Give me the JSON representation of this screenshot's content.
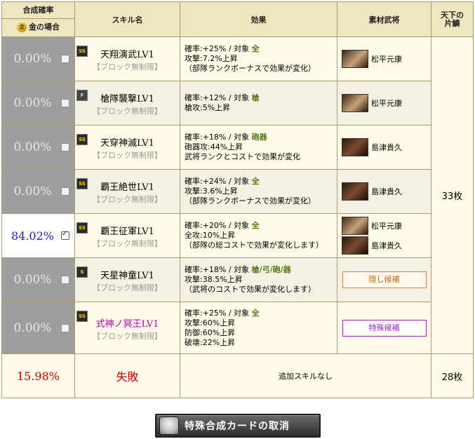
{
  "header": {
    "rate_title": "合成確率",
    "gold_case": "金の場合",
    "gold_coin": "金",
    "skill_name": "スキル名",
    "effect": "効果",
    "material": "素材武将",
    "fragments_1": "天下の",
    "fragments_2": "片鱗"
  },
  "rows": [
    {
      "rate": "0.00%",
      "rank": "SS",
      "name": "天翔演武LV1",
      "sub": "【ブロック無制限】",
      "e1a": "確率:+25%  /  対象 ",
      "e1b": "全",
      "e2": "攻撃:7.2%上昇",
      "e3": "（部隊ランクボーナスで効果が変化）",
      "generals": [
        "松平元康"
      ]
    },
    {
      "rate": "0.00%",
      "rank": "F",
      "name": "槍隊襲撃LV1",
      "sub": "【ブロック無制限】",
      "e1a": "確率:+12%  /  対象 ",
      "e1b": "槍",
      "e2": "槍攻:5%上昇",
      "e3": "",
      "generals": [
        "松平元康"
      ]
    },
    {
      "rate": "0.00%",
      "rank": "SS",
      "name": "天穿神滅LV1",
      "sub": "【ブロック無制限】",
      "e1a": "確率:+18%  /  対象 ",
      "e1b": "砲器",
      "e2": "砲器攻:44%上昇",
      "e3": "武将ランクとコストで効果が変化",
      "generals": [
        "島津貴久"
      ]
    },
    {
      "rate": "0.00%",
      "rank": "SS",
      "name": "覇王絶世LV1",
      "sub": "【ブロック無制限】",
      "e1a": "確率:+24%  /  対象 ",
      "e1b": "全",
      "e2": "攻撃:3.6%上昇",
      "e3": "（部隊ランクボーナスで効果が変化）",
      "generals": [
        "島津貴久"
      ]
    },
    {
      "rate": "84.02%",
      "rank": "SS",
      "name": "覇王征軍LV1",
      "sub": "【ブロック無制限】",
      "e1a": "確率:+20%  /  対象 ",
      "e1b": "全",
      "e2": "全攻:10%上昇",
      "e3": "（部隊の総コストで効果が変化します）",
      "generals": [
        "松平元康",
        "島津貴久"
      ]
    },
    {
      "rate": "0.00%",
      "rank": "S",
      "name": "天星神童LV1",
      "sub": "【ブロック無制限】",
      "e1a": "確率:+18%  /  対象 ",
      "e1b": "槍/弓/砲/器",
      "e2": "攻撃:38.5%上昇",
      "e3": "（武将のコストで効果が変化します）",
      "candidate": "隠し候補"
    },
    {
      "rate": "0.00%",
      "rank": "SS",
      "name": "式神ノ冥王LV1",
      "sub": "【ブロック無制限】",
      "e1a": "確率:+25%  /  対象 ",
      "e1b": "全",
      "e2": "攻撃:60%上昇",
      "e3": "防御:60%上昇",
      "e4": "破壊:22%上昇",
      "candidate": "特殊候補"
    }
  ],
  "fail_row": {
    "rate": "15.98%",
    "label": "失敗",
    "effect": "追加スキルなし",
    "fragments": "28枚"
  },
  "fragments_total": "33枚",
  "cancel_button": "特殊合成カードの取消"
}
